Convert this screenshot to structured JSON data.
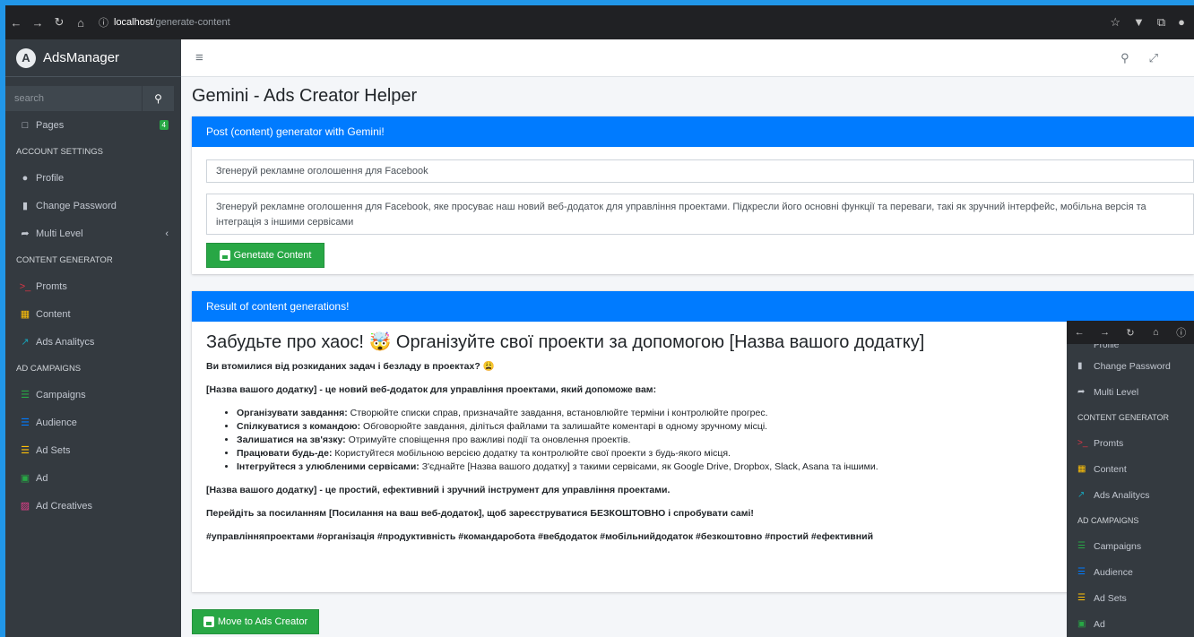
{
  "browser": {
    "url_host": "localhost",
    "url_path": "/generate-content"
  },
  "sidebar": {
    "brand": "AdsManager",
    "search_placeholder": "search",
    "pages_label": "Pages",
    "pages_badge": "4",
    "account_header": "ACCOUNT SETTINGS",
    "profile": "Profile",
    "change_password": "Change Password",
    "multi_level": "Multi Level",
    "content_header": "CONTENT GENERATOR",
    "promts": "Promts",
    "content": "Content",
    "ads_analytics": "Ads Analitycs",
    "campaigns_header": "AD CAMPAIGNS",
    "campaigns": "Campaigns",
    "audience": "Audience",
    "ad_sets": "Ad Sets",
    "ad": "Ad",
    "ad_creatives": "Ad Creatives"
  },
  "page": {
    "title": "Gemini - Ads Creator Helper"
  },
  "generator": {
    "header": "Post (content) generator with Gemini!",
    "prompt_title": "Згенеруй рекламне оголошення для Facebook",
    "prompt_body": "Згенеруй рекламне оголошення для Facebook, яке просуває наш новий веб-додаток для управління проектами. Підкресли його основні функції та переваги, такі як зручний інтерфейс, мобільна версія та інтеграція з іншими сервісами",
    "button": "Genetate Content"
  },
  "result": {
    "header": "Result of content generations!",
    "heading": "Забудьте про хаос! 🤯 Організуйте свої проекти за допомогою [Назва вашого додатку]",
    "intro": "Ви втомилися від розкиданих задач і безладу в проектах? 😩",
    "lead": "[Назва вашого додатку] - це новий веб-додаток для управління проектами, який допоможе вам:",
    "items": [
      {
        "bold": "Організувати завдання:",
        "text": " Створюйте списки справ, призначайте завдання, встановлюйте терміни і контролюйте прогрес."
      },
      {
        "bold": "Спілкуватися з командою:",
        "text": " Обговорюйте завдання, діліться файлами та залишайте коментарі в одному зручному місці."
      },
      {
        "bold": "Залишатися на зв'язку:",
        "text": " Отримуйте сповіщення про важливі події та оновлення проектів."
      },
      {
        "bold": "Працювати будь-де:",
        "text": " Користуйтеся мобільною версією додатку та контролюйте свої проекти з будь-якого місця."
      },
      {
        "bold": "Інтегруйтеся з улюбленими сервісами:",
        "text": " З'єднайте [Назва вашого додатку] з такими сервісами, як Google Drive, Dropbox, Slack, Asana та іншими."
      }
    ],
    "summary": "[Назва вашого додатку] - це простий, ефективний і зручний інструмент для управління проектами.",
    "cta": "Перейдіть за посиланням [Посилання на ваш веб-додаток], щоб зареєструватися БЕЗКОШТОВНО і спробувати самі!",
    "hashtags": "#управлінняпроектами #організація #продуктивність #командаробота #вебдодаток #мобільнийдодаток #безкоштовно #простий #ефективний",
    "move_button": "Move to Ads Creator"
  },
  "overlay": {
    "profile_partial": "Profile",
    "change_password": "Change Password",
    "multi_level": "Multi Level",
    "content_header": "CONTENT GENERATOR",
    "promts": "Promts",
    "content": "Content",
    "ads_analytics": "Ads Analitycs",
    "campaigns_header": "AD CAMPAIGNS",
    "campaigns": "Campaigns",
    "audience": "Audience",
    "ad_sets": "Ad Sets",
    "ad": "Ad"
  },
  "icons": {
    "back": "←",
    "forward": "→",
    "reload": "↻",
    "home": "⌂",
    "info": "ⓘ",
    "star": "☆",
    "menu": "≡",
    "search": "⚲",
    "expand": "⛶"
  },
  "colors": {
    "primary": "#007bff",
    "success": "#28a745",
    "sidebar": "#343a40",
    "promts_icon": "#dc3545",
    "content_icon": "#ffc107",
    "analytics_icon": "#17a2b8",
    "campaigns_icon": "#28a745",
    "audience_icon": "#007bff",
    "adsets_icon": "#ffc107",
    "ad_icon": "#28a745",
    "creatives_icon": "#e83e8c"
  }
}
